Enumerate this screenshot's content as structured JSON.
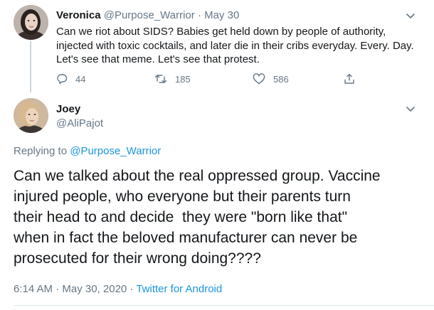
{
  "parent_tweet": {
    "author_name": "Veronica",
    "author_handle": "@Purpose_Warrior",
    "separator": "·",
    "date": "May 30",
    "text_lines": [
      "Can we riot about SIDS? Babies get held down by people of authority,",
      "injected with toxic cocktails, and later die in their cribs everyday. Every. Day.",
      "Let's see that meme. Let's see that protest."
    ],
    "reply_count": "44",
    "retweet_count": "185",
    "like_count": "586"
  },
  "main_tweet": {
    "author_name": "Joey",
    "author_handle": "@AliPajot",
    "replying_to_prefix": "Replying to",
    "replying_to_handle": "@Purpose_Warrior",
    "text_lines": [
      "Can we talked about the real oppressed group. Vaccine",
      "injured people, who everyone but their parents turn",
      "their head to and decide  they were \"born like that\"",
      "when in fact the beloved manufacturer can never be",
      "prosecuted for their wrong doing????"
    ],
    "timestamp": "6:14 AM · May 30, 2020 ·",
    "source": "Twitter for Android"
  },
  "colors": {
    "text": "#14171a",
    "muted": "#657786",
    "link": "#1b95e0",
    "thread_line": "#ccd6dd"
  },
  "icons": [
    "reply-icon",
    "retweet-icon",
    "like-icon",
    "share-icon",
    "chevron-down-icon"
  ]
}
